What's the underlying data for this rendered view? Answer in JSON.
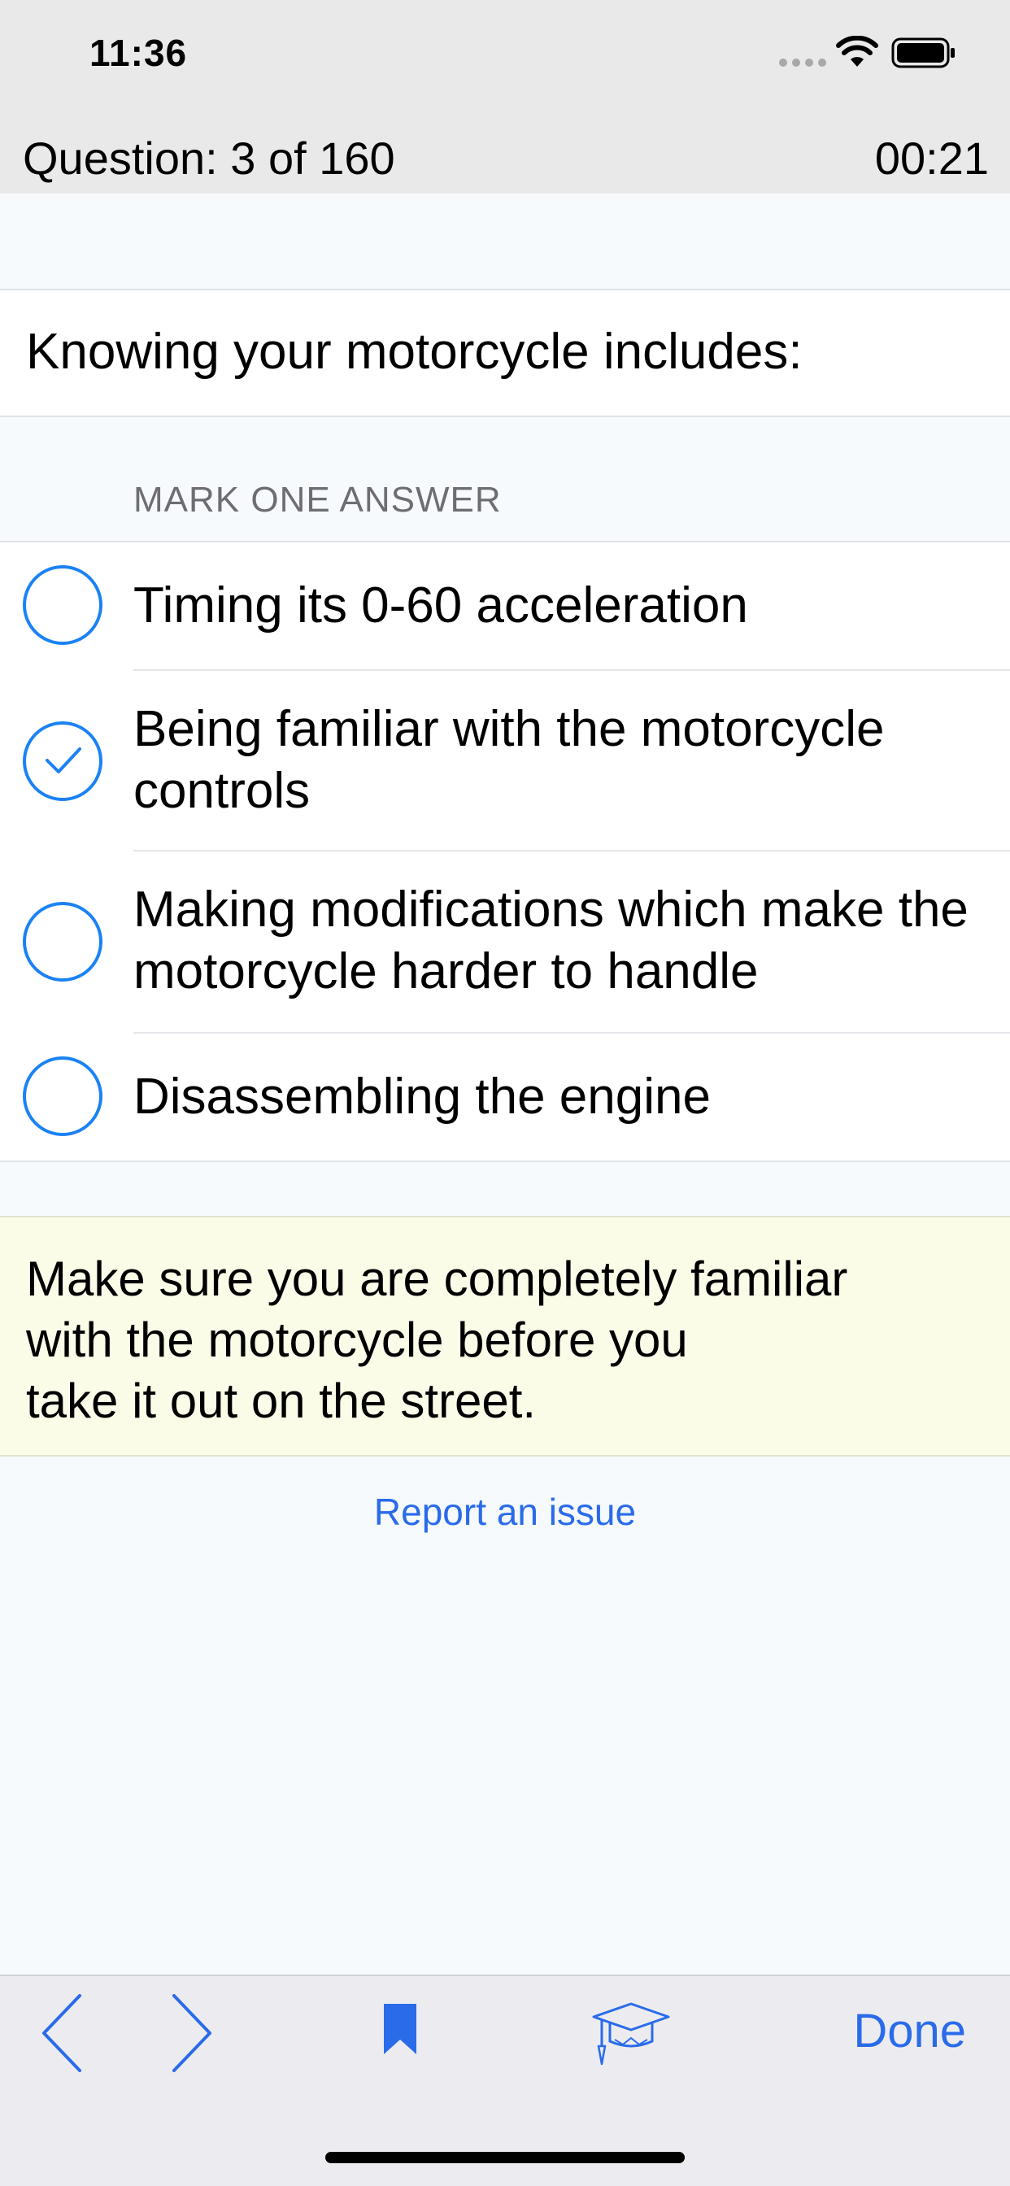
{
  "status_bar": {
    "time": "11:36"
  },
  "header": {
    "question_counter": "Question: 3 of 160",
    "timer": "00:21"
  },
  "question": {
    "text": "Knowing your motorcycle includes:"
  },
  "answers_section": {
    "label": "MARK ONE ANSWER"
  },
  "answers": [
    {
      "text": "Timing its 0-60 acceleration",
      "selected": false
    },
    {
      "text": "Being familiar with the motorcycle controls",
      "selected": true
    },
    {
      "text": "Making modifications which make the motorcycle harder to handle",
      "selected": false
    },
    {
      "text": "Disassembling the engine",
      "selected": false
    }
  ],
  "explanation": {
    "text": "Make sure you are completely familiar\nwith the motorcycle before you\ntake it out on the street."
  },
  "report_link": "Report an issue",
  "toolbar": {
    "done_label": "Done",
    "icons": [
      "chevron-left-icon",
      "chevron-right-icon",
      "bookmark-icon",
      "graduation-cap-icon"
    ]
  },
  "colors": {
    "accent": "#1b82f5",
    "link": "#2a6bea",
    "explanation_bg": "#fbfce8"
  }
}
